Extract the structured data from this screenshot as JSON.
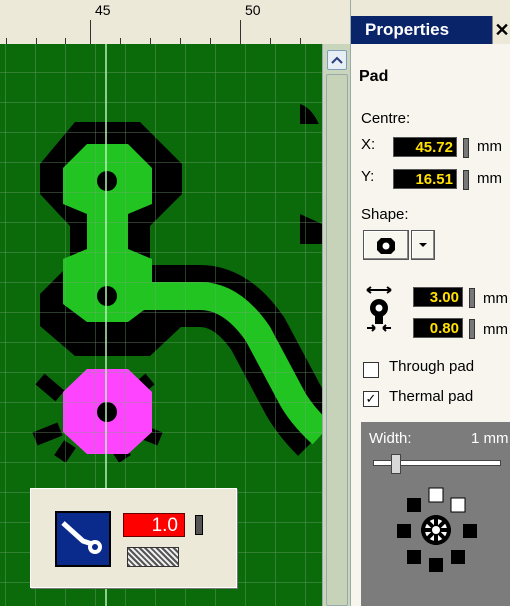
{
  "ruler": {
    "labels": [
      "45",
      "50"
    ]
  },
  "panel": {
    "title": "Properties",
    "close_glyph": "✕",
    "section": "Pad",
    "centre_label": "Centre:",
    "x_label": "X:",
    "x_value": "45.72",
    "y_label": "Y:",
    "y_value": "16.51",
    "unit": "mm",
    "shape_label": "Shape:",
    "size_outer": "3.00",
    "size_hole": "0.80",
    "size_unit": "mm",
    "through_pad_label": "Through pad",
    "through_pad_checked": false,
    "thermal_pad_label": "Thermal pad",
    "thermal_pad_checked": true,
    "thermal_width_label": "Width:",
    "thermal_width_value": "1 mm",
    "thermal_width_level": 0.25
  },
  "toolbar": {
    "width_value": "1.0"
  },
  "colors": {
    "board": "#0b6b0b",
    "copper": "#22c422",
    "selected_pad": "#ff44ff",
    "accent": "#0a246a",
    "value_text": "#ffe000"
  },
  "icons": {
    "scroll_up": "chevron-up-icon",
    "track_tool": "track-tool-icon",
    "pad_shape": "round-pad-icon",
    "size_diameter": "pad-diameter-icon"
  }
}
